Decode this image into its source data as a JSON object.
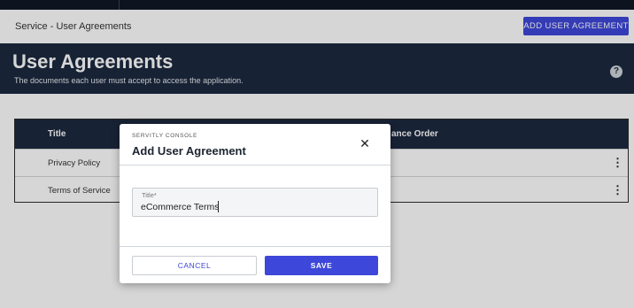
{
  "breadcrumb": "Service - User Agreements",
  "header": {
    "add_button_label": "ADD USER AGREEMENT"
  },
  "hero": {
    "title": "User Agreements",
    "subtitle": "The documents each user must accept to access the application.",
    "help_label": "?"
  },
  "table": {
    "columns": [
      "Title",
      "Acceptance Order"
    ],
    "columns_visible": [
      "Title",
      "ance Order"
    ],
    "rows": [
      {
        "title": "Privacy Policy",
        "menu_icon": "⋮"
      },
      {
        "title": "Terms of Service",
        "menu_icon": "⋮"
      }
    ]
  },
  "modal": {
    "kicker": "SERVITLY CONSOLE",
    "title": "Add User Agreement",
    "close_glyph": "✕",
    "field": {
      "label": "Title*",
      "value": "eCommerce Terms"
    },
    "cancel_label": "CANCEL",
    "save_label": "SAVE"
  },
  "colors": {
    "accent": "#3d47d9",
    "nav_dark": "#1c2940",
    "topbar": "#101826"
  }
}
